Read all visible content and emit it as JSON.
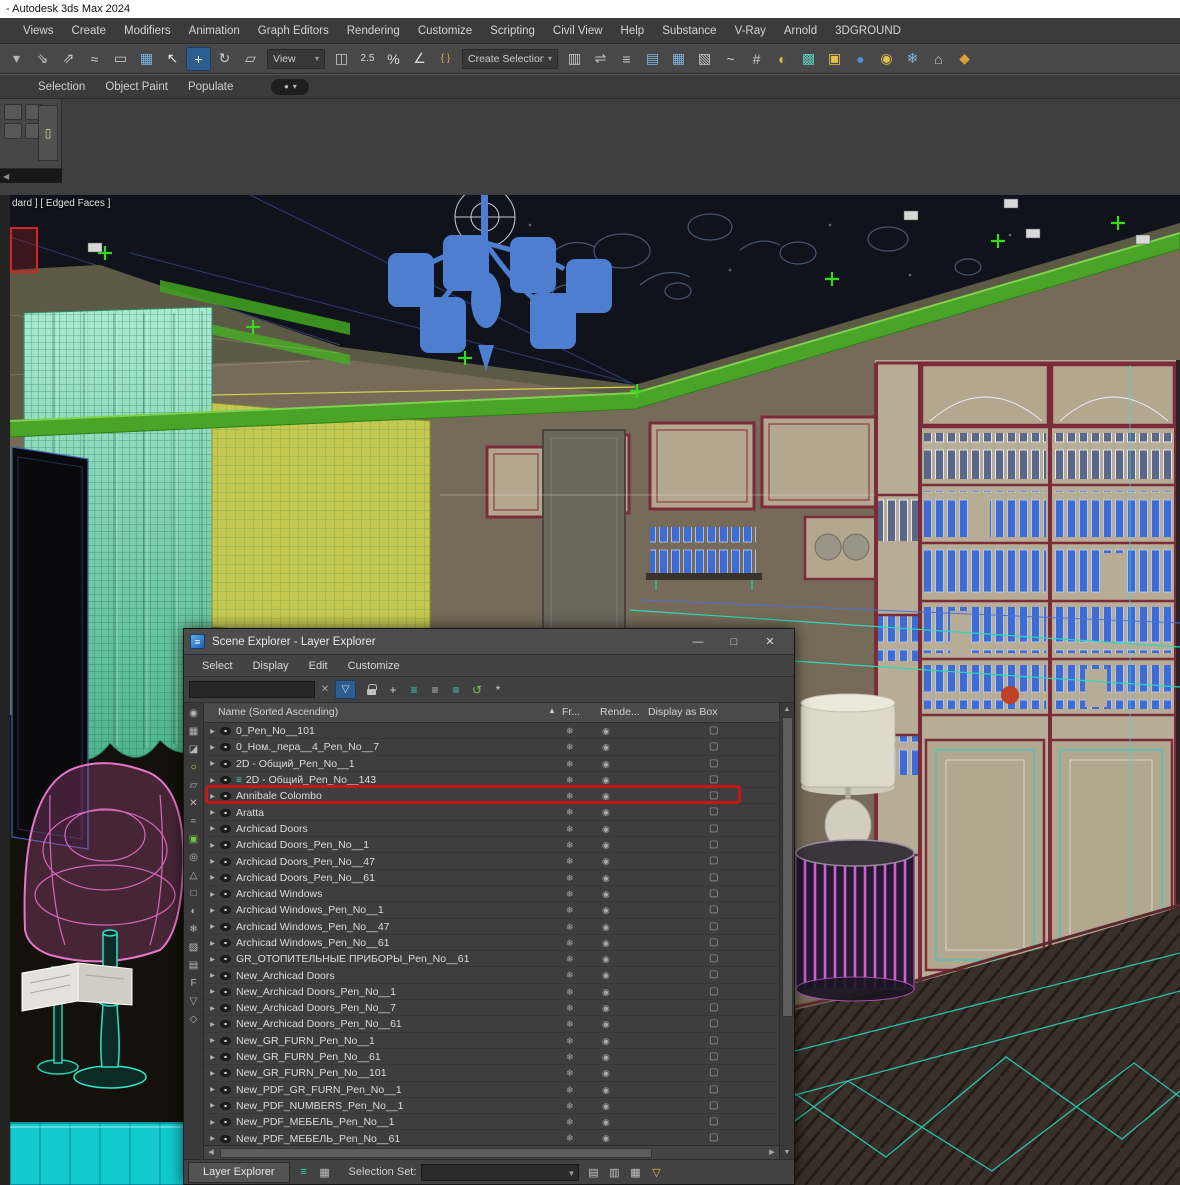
{
  "titlebar": {
    "title": "- Autodesk 3ds Max 2024"
  },
  "menubar": {
    "items": [
      "Views",
      "Create",
      "Modifiers",
      "Animation",
      "Graph Editors",
      "Rendering",
      "Customize",
      "Scripting",
      "Civil View",
      "Help",
      "Substance",
      "V-Ray",
      "Arnold",
      "3DGROUND"
    ]
  },
  "toolbar": {
    "items": [
      {
        "type": "icon",
        "name": "toolbar-flyout-arrow-icon",
        "glyph": "▾",
        "color": "#b8b8b8"
      },
      {
        "type": "icon",
        "name": "select-and-link-icon",
        "glyph": "⇘",
        "color": "#c8c8c8"
      },
      {
        "type": "icon",
        "name": "unlink-selection-icon",
        "glyph": "⇗",
        "color": "#c8c8c8"
      },
      {
        "type": "icon",
        "name": "bind-to-space-warp-icon",
        "glyph": "≈",
        "color": "#c8c8c8"
      },
      {
        "type": "icon",
        "name": "select-by-name-icon",
        "glyph": "▭",
        "color": "#c8c8c8"
      },
      {
        "type": "icon",
        "name": "selection-region-icon",
        "glyph": "▦",
        "color": "#7fb2e0"
      },
      {
        "type": "icon",
        "name": "select-object-icon",
        "glyph": "↖",
        "color": "#e8e8e8"
      },
      {
        "type": "icon",
        "name": "select-and-move-icon",
        "glyph": "+",
        "color": "#ffffff",
        "active": true
      },
      {
        "type": "icon",
        "name": "select-and-rotate-icon",
        "glyph": "↻",
        "color": "#c8c8c8"
      },
      {
        "type": "icon",
        "name": "select-and-scale-icon",
        "glyph": "▱",
        "color": "#c8c8c8"
      },
      {
        "type": "dropdown",
        "name": "reference-coordinate-dropdown",
        "label": "View",
        "width": 58
      },
      {
        "type": "icon",
        "name": "use-center-icon",
        "glyph": "◫",
        "color": "#c8c8c8"
      },
      {
        "type": "icon",
        "name": "snaps-toggle-icon",
        "glyph": "2.5",
        "color": "#d8d8d8"
      },
      {
        "type": "icon",
        "name": "percent-snap-icon",
        "glyph": "%",
        "color": "#d8d8d8"
      },
      {
        "type": "icon",
        "name": "angle-snap-icon",
        "glyph": "∠",
        "color": "#d8d8d8"
      },
      {
        "type": "icon",
        "name": "maxscript-icon",
        "glyph": "{ }",
        "color": "#d8a848"
      },
      {
        "type": "dropdown",
        "name": "named-selection-set-dropdown",
        "label": "Create Selection Se",
        "width": 96
      },
      {
        "type": "icon",
        "name": "edit-named-sets-icon",
        "glyph": "▥",
        "color": "#c8c8c8"
      },
      {
        "type": "icon",
        "name": "mirror-icon",
        "glyph": "⇌",
        "color": "#c8c8c8"
      },
      {
        "type": "icon",
        "name": "align-icon",
        "glyph": "≡",
        "color": "#c8c8c8"
      },
      {
        "type": "icon",
        "name": "toggle-scene-explorer-icon",
        "glyph": "▤",
        "color": "#7fb2e0"
      },
      {
        "type": "icon",
        "name": "toggle-layer-explorer-icon",
        "glyph": "▦",
        "color": "#7fb2e0"
      },
      {
        "type": "icon",
        "name": "toggle-ribbon-icon",
        "glyph": "▧",
        "color": "#c8c8c8"
      },
      {
        "type": "icon",
        "name": "curve-editor-icon",
        "glyph": "~",
        "color": "#c8c8c8"
      },
      {
        "type": "icon",
        "name": "schematic-view-icon",
        "glyph": "#",
        "color": "#c8c8c8"
      },
      {
        "type": "icon",
        "name": "material-editor-icon",
        "glyph": "◐",
        "color": "#e2c14a"
      },
      {
        "type": "icon",
        "name": "render-setup-icon",
        "glyph": "▩",
        "color": "#5ad0c0"
      },
      {
        "type": "icon",
        "name": "rendered-frame-icon",
        "glyph": "▣",
        "color": "#e2c14a"
      },
      {
        "type": "icon",
        "name": "render-production-icon",
        "glyph": "●",
        "color": "#4a90d8"
      },
      {
        "type": "icon",
        "name": "render-iterative-icon",
        "glyph": "◉",
        "color": "#e2c14a"
      },
      {
        "type": "icon",
        "name": "snap-tools-icon",
        "glyph": "❄",
        "color": "#7fb2e0"
      },
      {
        "type": "icon",
        "name": "home-icon",
        "glyph": "⌂",
        "color": "#c8c8c8"
      },
      {
        "type": "icon",
        "name": "utility-icon",
        "glyph": "◆",
        "color": "#d8a030"
      }
    ]
  },
  "ribbon": {
    "tabs": [
      "Selection",
      "Object Paint",
      "Populate"
    ],
    "pill": [
      "●",
      "▾"
    ]
  },
  "left_panel": {
    "tall_glyph": "▯",
    "strip_arrow": "◀"
  },
  "viewport": {
    "label": "dard ] [ Edged Faces ]"
  },
  "scene_explorer": {
    "title": "Scene Explorer - Layer Explorer",
    "title_icon_glyph": "≡",
    "window_controls": [
      {
        "name": "minimize-button",
        "glyph": "—"
      },
      {
        "name": "maximize-button",
        "glyph": "□"
      },
      {
        "name": "close-button",
        "glyph": "✕"
      }
    ],
    "menu_items": [
      "Select",
      "Display",
      "Edit",
      "Customize"
    ],
    "search_value": "",
    "clear_search_glyph": "✕",
    "funnel_glyph": "▽",
    "toolbar_icons": [
      {
        "name": "lock-layers-icon",
        "css": "lock"
      },
      {
        "name": "add-layer-icon",
        "glyph": "+",
        "color": "#d0d0d0"
      },
      {
        "name": "create-new-layer-icon",
        "glyph": "≡",
        "color": "#3ad2b8"
      },
      {
        "name": "add-selection-to-layer-icon",
        "glyph": "≡",
        "color": "#c0c0c0"
      },
      {
        "name": "select-layer-objects-icon",
        "glyph": "≡",
        "color": "#3ad2b8"
      },
      {
        "name": "sync-layers-icon",
        "glyph": "↺",
        "color": "#7ac142"
      },
      {
        "name": "layer-properties-icon",
        "glyph": "*",
        "color": "#d0d0d0"
      }
    ],
    "header": {
      "name_label": "Name (Sorted Ascending)",
      "sort_icon": "▲",
      "columns": [
        "Fr...",
        "Rende...",
        "Display as Box"
      ]
    },
    "filter_icons": [
      {
        "name": "display-all-icon",
        "glyph": "◉"
      },
      {
        "name": "display-geometry-icon",
        "glyph": "▦"
      },
      {
        "name": "display-shapes-icon",
        "glyph": "◪"
      },
      {
        "name": "display-lights-icon",
        "glyph": "○",
        "color": "#e8d060"
      },
      {
        "name": "display-cameras-icon",
        "glyph": "▱"
      },
      {
        "name": "display-helpers-icon",
        "glyph": "✕"
      },
      {
        "name": "display-spacewarps-icon",
        "glyph": "≈"
      },
      {
        "name": "display-groups-icon",
        "glyph": "▣",
        "color": "#7ac142"
      },
      {
        "name": "display-xrefs-icon",
        "glyph": "◎"
      },
      {
        "name": "display-bones-icon",
        "glyph": "△"
      },
      {
        "name": "display-containers-icon",
        "glyph": "□"
      },
      {
        "name": "display-materials-icon",
        "glyph": "◐"
      },
      {
        "name": "display-frozen-icon",
        "glyph": "❄"
      },
      {
        "name": "display-hidden-icon",
        "glyph": "▨"
      },
      {
        "name": "display-children-icon",
        "glyph": "▤"
      },
      {
        "name": "display-f-icon",
        "glyph": "F"
      },
      {
        "name": "display-selection-filter-icon",
        "glyph": "▽"
      },
      {
        "name": "display-link-icon",
        "glyph": "◇"
      }
    ],
    "row_icons": {
      "expand": "▶",
      "frozen": "❄",
      "render": "◉",
      "box": "▢",
      "active_layer": "≡"
    },
    "layers": [
      {
        "name": "0_Pen_No__101"
      },
      {
        "name": "0_Ном._пера__4_Pen_No__7"
      },
      {
        "name": "2D - Общий_Pen_No__1"
      },
      {
        "name": "2D - Общий_Pen_No__143",
        "active": true
      },
      {
        "name": "Annibale Colombo",
        "highlighted": true
      },
      {
        "name": "Aratta"
      },
      {
        "name": "Archicad Doors"
      },
      {
        "name": "Archicad Doors_Pen_No__1"
      },
      {
        "name": "Archicad Doors_Pen_No__47"
      },
      {
        "name": "Archicad Doors_Pen_No__61"
      },
      {
        "name": "Archicad Windows"
      },
      {
        "name": "Archicad Windows_Pen_No__1"
      },
      {
        "name": "Archicad Windows_Pen_No__47"
      },
      {
        "name": "Archicad Windows_Pen_No__61"
      },
      {
        "name": "GR_ОТОПИТЕЛЬНЫЕ ПРИБОРЫ_Pen_No__61"
      },
      {
        "name": "New_Archicad Doors"
      },
      {
        "name": "New_Archicad Doors_Pen_No__1"
      },
      {
        "name": "New_Archicad Doors_Pen_No__7"
      },
      {
        "name": "New_Archicad Doors_Pen_No__61"
      },
      {
        "name": "New_GR_FURN_Pen_No__1"
      },
      {
        "name": "New_GR_FURN_Pen_No__61"
      },
      {
        "name": "New_GR_FURN_Pen_No__101"
      },
      {
        "name": "New_PDF_GR_FURN_Pen_No__1"
      },
      {
        "name": "New_PDF_NUMBERS_Pen_No__1"
      },
      {
        "name": "New_PDF_МЕБЕЛЬ_Pen_No__1"
      },
      {
        "name": "New_PDF_МЕБЕЛЬ_Pen_No__61"
      }
    ],
    "footer": {
      "tab": "Layer Explorer",
      "left_icons": [
        {
          "name": "footer-new-layer-icon",
          "glyph": "≡",
          "color": "#3ad2b8"
        },
        {
          "name": "footer-grid-icon",
          "glyph": "▦",
          "color": "#c0c0c0"
        }
      ],
      "selection_set_label": "Selection Set:",
      "selection_set_value": "",
      "right_icons": [
        {
          "name": "footer-edit-set-icon",
          "glyph": "▤"
        },
        {
          "name": "footer-combine-set-icon",
          "glyph": "▥"
        },
        {
          "name": "footer-subtract-set-icon",
          "glyph": "▦"
        },
        {
          "name": "footer-filter-icon",
          "glyph": "▽",
          "color": "#e2c14a"
        }
      ]
    }
  },
  "colors": {
    "highlight_ring": "#c41717",
    "active_tool_blue": "#2d5d8e",
    "teal_accent": "#3ad2b8",
    "molding_green": "#49a428",
    "chandelier_blue": "#4d7ed0",
    "curtain_teal": "#6fd0a8",
    "bookcase_maroon": "#7c2b38"
  }
}
